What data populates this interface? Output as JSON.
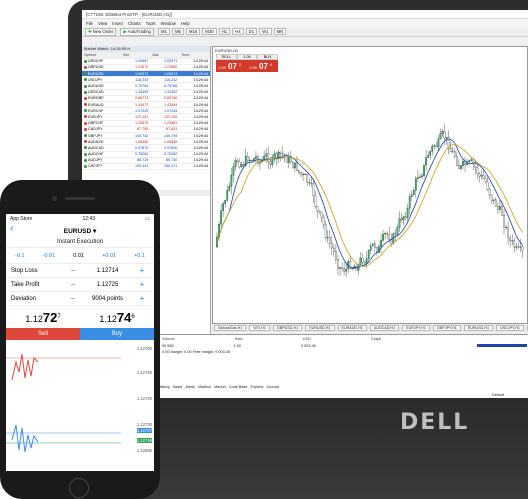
{
  "laptop": {
    "brand": "DELL",
    "window_title": "[C77186: EliteBot ProSTP - [EURUSD,H1]]",
    "menu": [
      "File",
      "View",
      "Insert",
      "Charts",
      "Tools",
      "Window",
      "Help"
    ],
    "toolbar": {
      "new_order": "New Order",
      "autotrading": "AutoTrading",
      "timeframes": [
        "M1",
        "M5",
        "M15",
        "M30",
        "H1",
        "H4",
        "D1",
        "W1",
        "MN"
      ]
    },
    "market_watch": {
      "header": "Market Watch: 14:36:55 H",
      "columns": [
        "Symbol",
        "Bid",
        "Ask",
        "Time"
      ],
      "rows": [
        {
          "symbol": "USDCHF",
          "bid": "1.02687",
          "ask": "1.02971",
          "time": "14:29:44",
          "dir": "up"
        },
        {
          "symbol": "GBPUSD",
          "bid": "1.21570",
          "ask": "1.21580",
          "time": "14:29:44",
          "dir": "dn"
        },
        {
          "symbol": "EURUSD",
          "bid": "1.09072",
          "ask": "1.09074",
          "time": "14:29:44",
          "dir": "sel"
        },
        {
          "symbol": "USDJPY",
          "bid": "116.240",
          "ask": "116.242",
          "time": "14:29:44",
          "dir": "up"
        },
        {
          "symbol": "AUDUSD",
          "bid": "0.75760",
          "ask": "0.75766",
          "time": "14:29:44",
          "dir": "up"
        },
        {
          "symbol": "USDCAD",
          "bid": "1.32499",
          "ask": "1.32452",
          "time": "14:29:44",
          "dir": "up"
        },
        {
          "symbol": "EURGBP",
          "bid": "0.89773",
          "ask": "0.89780",
          "time": "14:29:44",
          "dir": "dn"
        },
        {
          "symbol": "EURAUD",
          "bid": "1.43472",
          "ask": "1.43484",
          "time": "14:29:44",
          "dir": "dn"
        },
        {
          "symbol": "EURCHF",
          "bid": "1.07225",
          "ask": "1.07244",
          "time": "14:29:44",
          "dir": "up"
        },
        {
          "symbol": "EURJPY",
          "bid": "122.151",
          "ask": "122.159",
          "time": "14:29:44",
          "dir": "dn"
        },
        {
          "symbol": "GBPCHF",
          "bid": "1.23570",
          "ask": "1.23581",
          "time": "14:29:44",
          "dir": "dn"
        },
        {
          "symbol": "CADJPY",
          "bid": "87.790",
          "ask": "87.801",
          "time": "14:29:44",
          "dir": "dn"
        },
        {
          "symbol": "GBPJPY",
          "bid": "140.742",
          "ask": "140.749",
          "time": "14:29:44",
          "dir": "up"
        },
        {
          "symbol": "AUDNZD",
          "bid": "1.05450",
          "ask": "1.05559",
          "time": "14:29:44",
          "dir": "dn"
        },
        {
          "symbol": "AUDCAD",
          "bid": "0.97870",
          "ask": "0.97840",
          "time": "14:29:44",
          "dir": "up"
        },
        {
          "symbol": "AUDCHF",
          "bid": "0.75262",
          "ask": "0.75282",
          "time": "14:29:44",
          "dir": "up"
        },
        {
          "symbol": "AUDJPY",
          "bid": "85.719",
          "ask": "85.730",
          "time": "14:29:44",
          "dir": "up"
        },
        {
          "symbol": "CHFJPY",
          "bid": "109.441",
          "ask": "109.471",
          "time": "14:29:44",
          "dir": "up"
        }
      ],
      "tabs": [
        "Symbols",
        "Tick Chart"
      ]
    },
    "chart": {
      "title": "EURUSD,H1",
      "trade_panel": {
        "sell": "SELL",
        "buy": "BUY",
        "lot": "1.00",
        "sell_big": "07",
        "sell_small": "1.09",
        "sell_sup": "2",
        "buy_big": "07",
        "buy_small": "1.09",
        "buy_sup": "4"
      },
      "tabs": [
        "NaturalGas,H1",
        "WTI,H1",
        "GBPUSD,H1",
        "EURUSD,H1",
        "EURAUD,H1",
        "AUDCAD,H1",
        "EURJPY,H1",
        "GBPJPY,H1",
        "EURUSD,H1",
        "USDJPY,H1",
        "NaturalGas,H1"
      ]
    },
    "terminal": {
      "cols": [
        "Volume",
        "Rate",
        "USD",
        "Graph"
      ],
      "row": [
        "90 555",
        "1.00",
        "9 003.45"
      ],
      "balance": "0.00  Margin: 0.00  Free margin: 9 003.45",
      "tabs": [
        "History",
        "News",
        "Alerts",
        "Mailbox",
        "Market",
        "Code Base",
        "Experts",
        "Journal"
      ],
      "status": "Default"
    }
  },
  "phone": {
    "status_left": "App Store",
    "time": "12:43",
    "symbol": "EURUSD",
    "execution": "Instant Execution",
    "volumes": [
      "-0.1",
      "-0.01",
      "0.01",
      "+0.01",
      "+0.1"
    ],
    "params": [
      {
        "label": "Stop Loss",
        "value": "1.12714"
      },
      {
        "label": "Take Profit",
        "value": "1.12725"
      },
      {
        "label": "Deviation",
        "value": "9004 points"
      }
    ],
    "bid": {
      "pre": "1.12",
      "big": "72",
      "sup": "7"
    },
    "ask": {
      "pre": "1.12",
      "big": "74",
      "sup": "6"
    },
    "sell_label": "Sell",
    "buy_label": "Buy",
    "levels": [
      "1.12760",
      "1.12740",
      "1.12720",
      "1.12700",
      "1.12680",
      "1.12727",
      "1.12746"
    ]
  }
}
